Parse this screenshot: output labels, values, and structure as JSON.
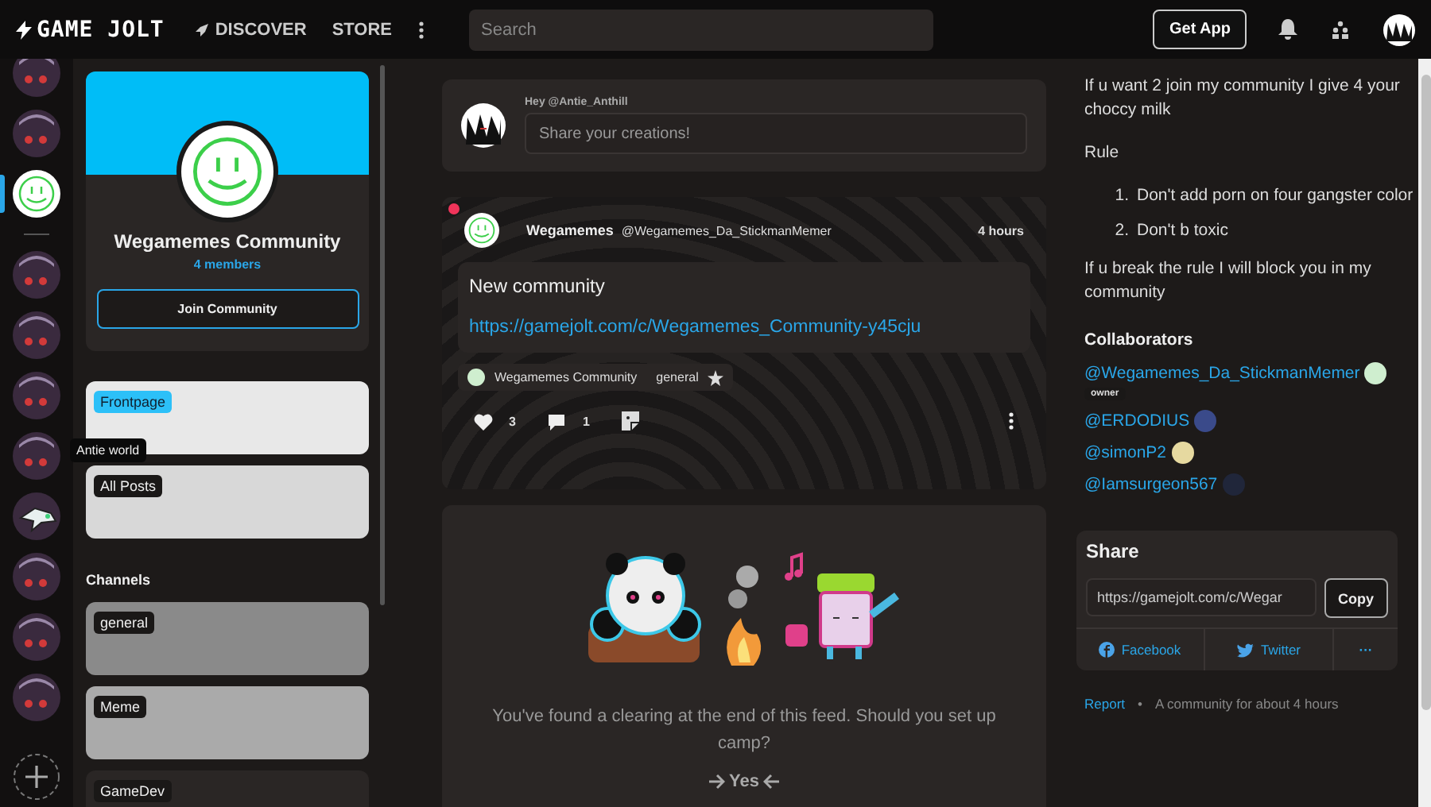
{
  "topbar": {
    "logo": "GAME JOLT",
    "links": [
      {
        "label": "DISCOVER",
        "kind": "rocket"
      },
      {
        "label": "STORE",
        "kind": "plain"
      }
    ],
    "search": {
      "placeholder": "Search"
    },
    "get_app": "Get App"
  },
  "rail": {
    "items": [
      {
        "kind": "dark",
        "selected": false
      },
      {
        "kind": "dark",
        "selected": false
      },
      {
        "kind": "smiley",
        "selected": true
      },
      {
        "kind": "divider"
      },
      {
        "kind": "dark",
        "selected": false
      },
      {
        "kind": "dark",
        "selected": false
      },
      {
        "kind": "dark",
        "selected": false
      },
      {
        "kind": "dark",
        "selected": false
      },
      {
        "kind": "shark",
        "selected": false
      },
      {
        "kind": "dark",
        "selected": false
      },
      {
        "kind": "dark",
        "selected": false
      },
      {
        "kind": "dark",
        "selected": false
      }
    ],
    "tooltip": "Antie world"
  },
  "community": {
    "name": "Wegamemes Community",
    "members": "4 members",
    "join": "Join Community",
    "nav": [
      {
        "label": "Frontpage",
        "selected": true
      },
      {
        "label": "All Posts",
        "selected": false
      }
    ],
    "channels_heading": "Channels",
    "channels": [
      "general",
      "Meme",
      "GameDev"
    ]
  },
  "composer": {
    "greeting": "Hey @Antie_Anthill",
    "placeholder": "Share your creations!"
  },
  "post": {
    "unread": true,
    "author": "Wegamemes",
    "handle": "@Wegamemes_Da_StickmanMemer",
    "time": "4 hours",
    "title": "New community",
    "link": "https://gamejolt.com/c/Wegamemes_Community-y45cju",
    "community_tag": "Wegamemes Community",
    "channel_tag": "general",
    "likes": "3",
    "comments": "1"
  },
  "feed_end": {
    "message": "You've found a clearing at the end of this feed. Should you set up camp?",
    "action": "Yes"
  },
  "about": {
    "description": "If u want 2 join my community I give 4 your choccy milk",
    "rules_heading": "Rule",
    "rules": [
      {
        "number": "1.",
        "text": "Don't add porn on four gangster color"
      },
      {
        "number": "2.",
        "text": "Don't b toxic"
      }
    ],
    "warning": "If u break the rule I will block you in my community",
    "collaborators_heading": "Collaborators",
    "collaborators": [
      {
        "handle": "@Wegamemes_Da_StickmanMemer",
        "badge": "owner",
        "color": "#cfeecf"
      },
      {
        "handle": "@ERDODIUS",
        "color": "#3a4a8a"
      },
      {
        "handle": "@simonP2",
        "color": "#e6d9a0"
      },
      {
        "handle": "@Iamsurgeon567",
        "color": "#20263a"
      }
    ]
  },
  "share": {
    "heading": "Share",
    "url": "https://gamejolt.com/c/Wegar",
    "copy": "Copy",
    "facebook": "Facebook",
    "twitter": "Twitter",
    "more": "···"
  },
  "footer": {
    "report": "Report",
    "separator": "•",
    "age": "A community for about 4 hours"
  }
}
